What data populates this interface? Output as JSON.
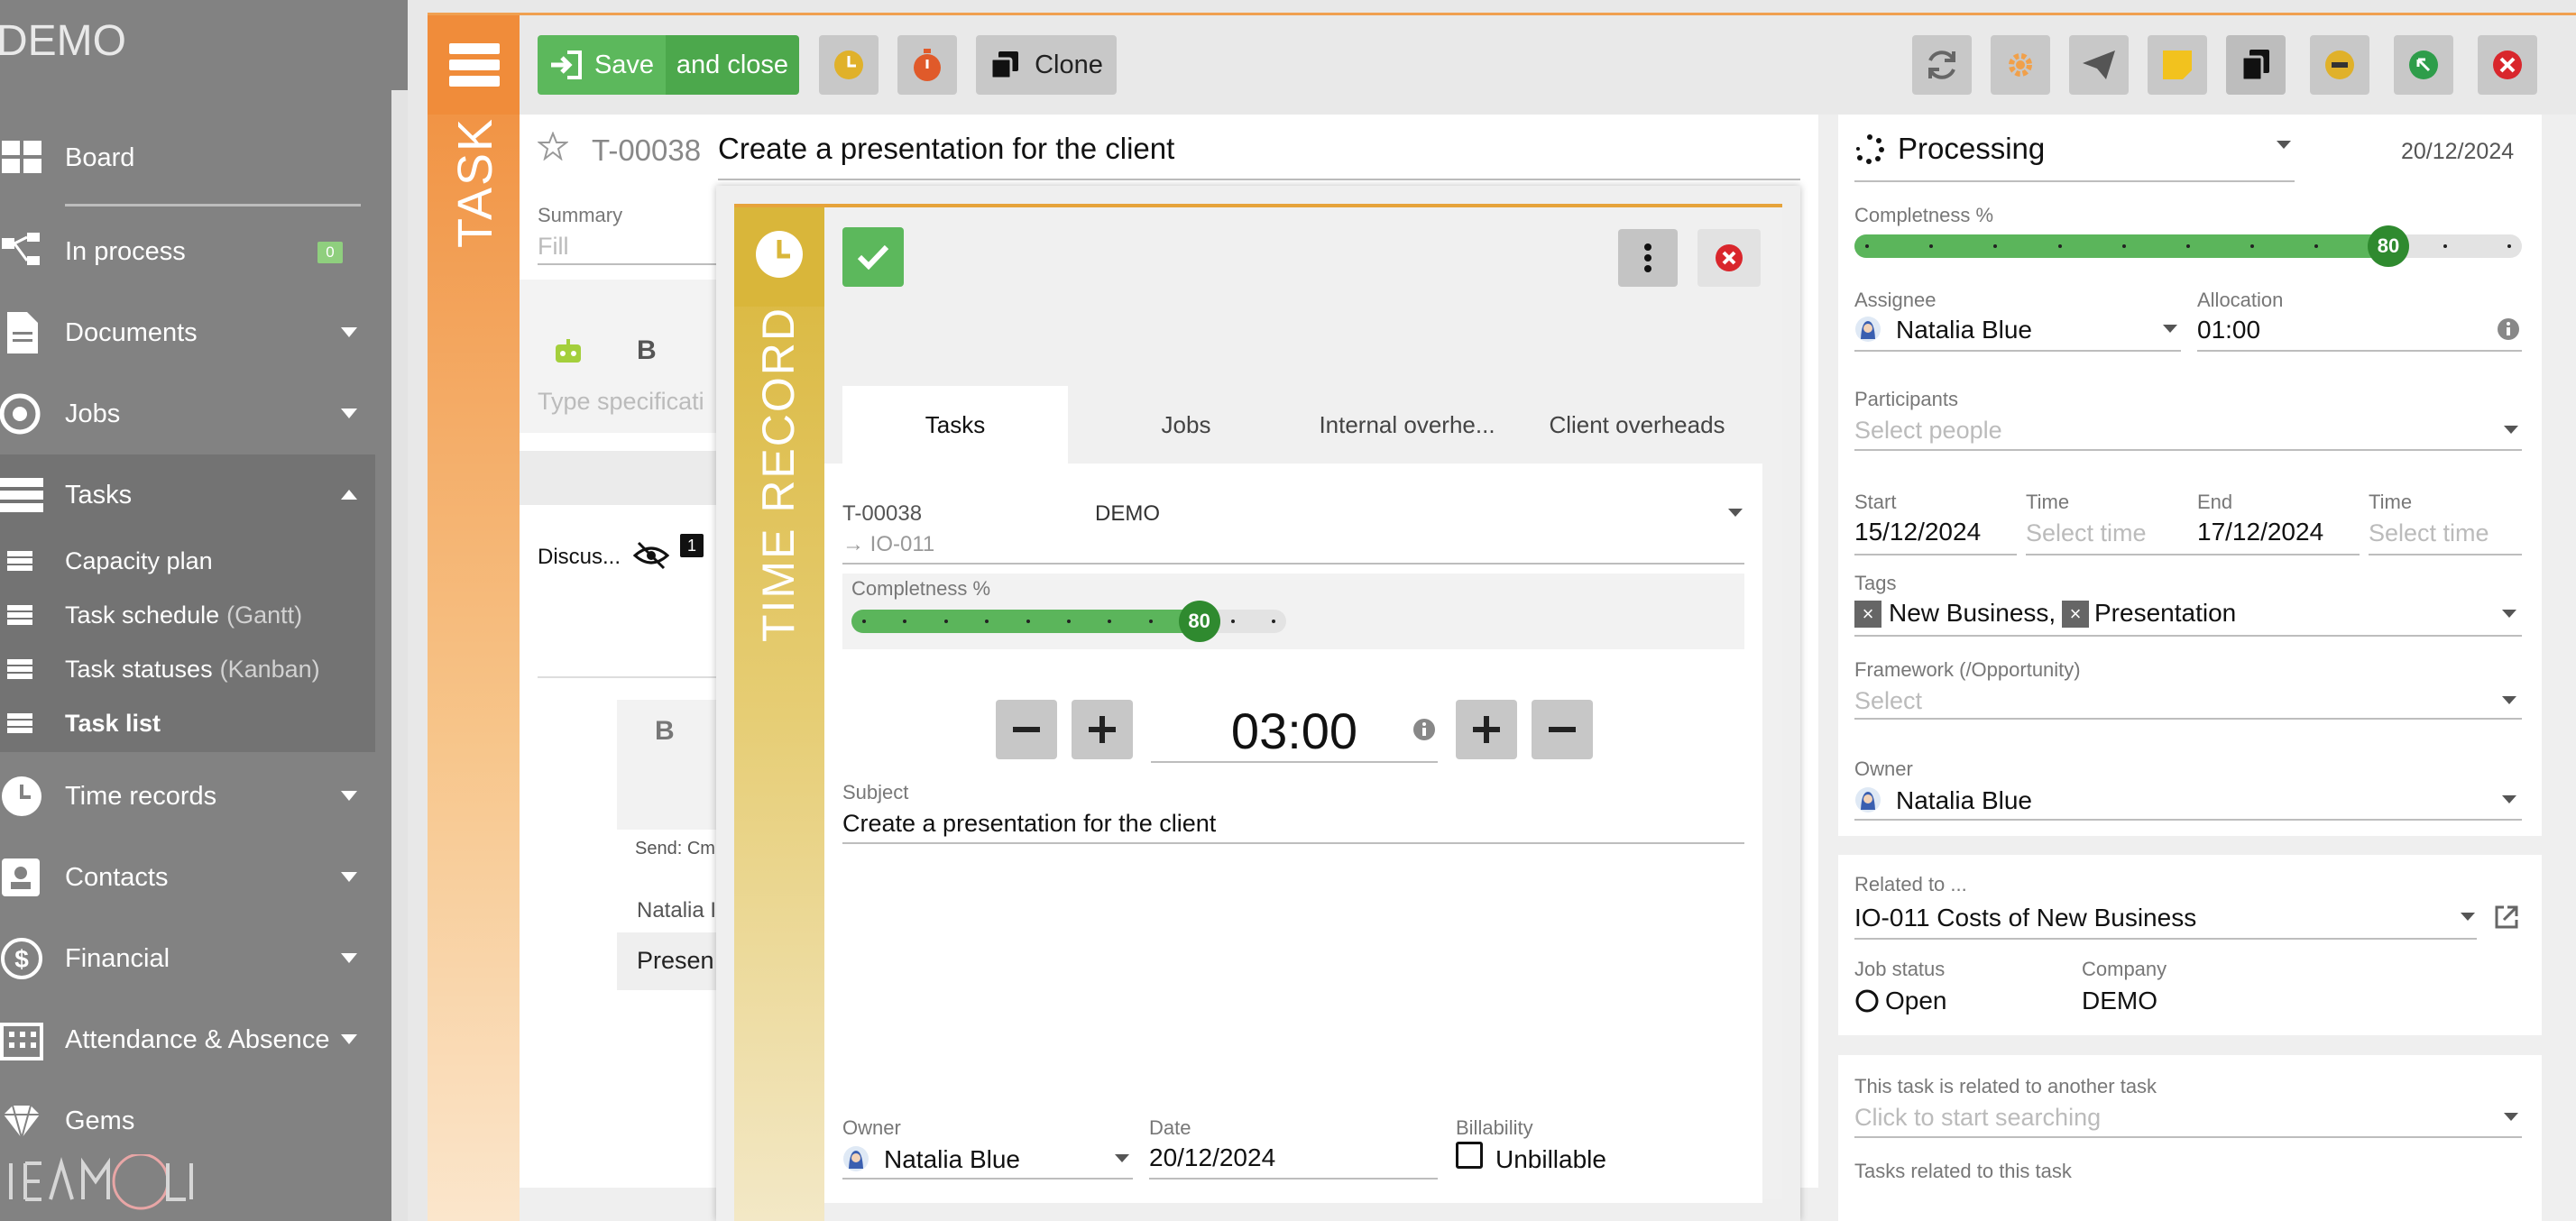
{
  "sidebar": {
    "brand": "DEMO",
    "items": [
      {
        "label": "Board"
      },
      {
        "label": "In process",
        "badge": "0"
      },
      {
        "label": "Documents"
      },
      {
        "label": "Jobs"
      },
      {
        "label": "Tasks"
      },
      {
        "label": "Time records"
      },
      {
        "label": "Contacts"
      },
      {
        "label": "Financial"
      },
      {
        "label": "Attendance & Absence"
      },
      {
        "label": "Gems"
      }
    ],
    "subitems": [
      {
        "label": "Capacity plan",
        "suffix": ""
      },
      {
        "label": "Task schedule",
        "suffix": "(Gantt)"
      },
      {
        "label": "Task statuses",
        "suffix": "(Kanban)"
      },
      {
        "label": "Task list",
        "suffix": ""
      }
    ]
  },
  "toolbar": {
    "save_label": "Save",
    "save_close_label": "and close",
    "clone_label": "Clone"
  },
  "task": {
    "rail_label": "TASK",
    "id": "T-00038",
    "title": "Create a presentation for the client",
    "summary_label": "Summary",
    "summary_placeholder": "Fill",
    "bold": "B",
    "spec_placeholder": "Type specificati",
    "discuss_label": "Discus...",
    "discuss_count": "1",
    "send_label": "Send: Cm",
    "comment_author": "Natalia I",
    "comment_text": "Presen"
  },
  "details": {
    "status": "Processing",
    "status_date": "20/12/2024",
    "completeness_label": "Completness %",
    "completeness": 80,
    "assignee_label": "Assignee",
    "assignee": "Natalia Blue",
    "allocation_label": "Allocation",
    "allocation": "01:00",
    "participants_label": "Participants",
    "participants_placeholder": "Select people",
    "start_label": "Start",
    "start": "15/12/2024",
    "start_time_label": "Time",
    "start_time_placeholder": "Select time",
    "end_label": "End",
    "end": "17/12/2024",
    "end_time_label": "Time",
    "end_time_placeholder": "Select time",
    "tags_label": "Tags",
    "tags": [
      "New Business,",
      "Presentation"
    ],
    "framework_label": "Framework (/Opportunity)",
    "framework_placeholder": "Select",
    "owner_label": "Owner",
    "owner": "Natalia Blue",
    "related_label": "Related to ...",
    "related": "IO-011 Costs of New Business",
    "job_status_label": "Job status",
    "job_status": "Open",
    "company_label": "Company",
    "company": "DEMO",
    "related_task_label": "This task is related to another task",
    "related_task_placeholder": "Click to start searching",
    "tasks_related_label": "Tasks related to this task"
  },
  "time_record": {
    "rail_label": "TIME RECORD",
    "tabs": [
      "Tasks",
      "Jobs",
      "Internal overhe...",
      "Client overheads"
    ],
    "task_id": "T-00038",
    "company": "DEMO",
    "job_ref": "IO-011",
    "completeness_label": "Completness %",
    "completeness": 80,
    "duration": "03:00",
    "subject_label": "Subject",
    "subject": "Create a presentation for the client",
    "owner_label": "Owner",
    "owner": "Natalia Blue",
    "date_label": "Date",
    "date": "20/12/2024",
    "billability_label": "Billability",
    "billability": "Unbillable"
  },
  "colors": {
    "save_green": "#5cb85c",
    "task_orange": "#f08c3a",
    "time_record_gold": "#d9b63a",
    "progress_green": "#5bb55b",
    "danger_red": "#d9262c",
    "sidebar_grey": "#828282"
  }
}
